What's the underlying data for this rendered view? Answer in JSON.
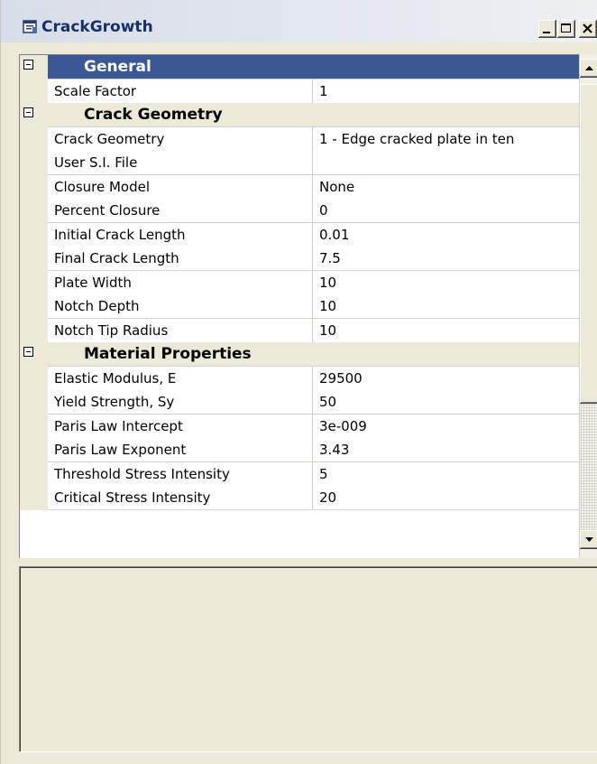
{
  "window": {
    "title": "CrackGrowth",
    "icon": "property-window-icon",
    "controls": [
      "minimize-icon",
      "maximize-icon",
      "close-icon"
    ]
  },
  "colors": {
    "selected_category_bg": "#3b5894",
    "gutter_bg": "#ece9d8",
    "title_text": "#16306a"
  },
  "grid": {
    "categories": [
      {
        "label": "General",
        "selected": true,
        "properties": [
          {
            "name": "Scale Factor",
            "value": "1"
          }
        ]
      },
      {
        "label": "Crack Geometry",
        "selected": false,
        "properties": [
          {
            "name": "Crack Geometry",
            "value": "1 - Edge cracked plate in ten"
          },
          {
            "name": "User S.I. File",
            "value": ""
          },
          {
            "name": "Closure Model",
            "value": "None"
          },
          {
            "name": "Percent Closure",
            "value": "0"
          },
          {
            "name": "Initial Crack Length",
            "value": "0.01"
          },
          {
            "name": "Final Crack Length",
            "value": "7.5"
          },
          {
            "name": "Plate Width",
            "value": "10"
          },
          {
            "name": "Notch Depth",
            "value": "10"
          },
          {
            "name": "Notch Tip Radius",
            "value": "10"
          }
        ]
      },
      {
        "label": "Material Properties",
        "selected": false,
        "properties": [
          {
            "name": "Elastic Modulus, E",
            "value": "29500"
          },
          {
            "name": "Yield Strength, Sy",
            "value": "50"
          },
          {
            "name": "Paris Law Intercept",
            "value": "3e-009"
          },
          {
            "name": "Paris Law Exponent",
            "value": "3.43"
          },
          {
            "name": "Threshold Stress Intensity",
            "value": "5"
          },
          {
            "name": "Critical Stress Intensity",
            "value": "20"
          }
        ]
      }
    ]
  },
  "description": {
    "title": "",
    "text": ""
  }
}
